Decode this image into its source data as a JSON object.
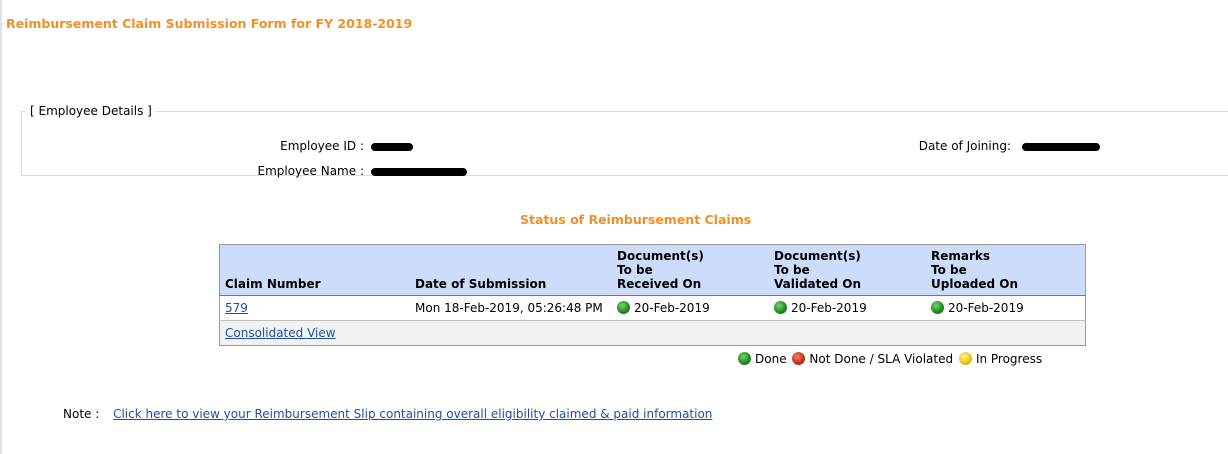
{
  "page": {
    "title": "Reimbursement Claim Submission Form for FY 2018-2019"
  },
  "employee_details": {
    "legend": "[ Employee Details ]",
    "employee_id_label": "Employee ID :",
    "employee_name_label": "Employee Name :",
    "date_of_joining_label": "Date of Joining:"
  },
  "status": {
    "title": "Status of Reimbursement Claims",
    "columns": {
      "claim_number": "Claim Number",
      "date_of_submission": "Date of Submission",
      "doc_received_1": "Document(s)",
      "doc_received_2": "To be",
      "doc_received_3": "Received On",
      "doc_validated_1": "Document(s)",
      "doc_validated_2": "To be",
      "doc_validated_3": "Validated On",
      "remarks_1": "Remarks",
      "remarks_2": "To be",
      "remarks_3": "Uploaded On"
    },
    "rows": [
      {
        "claim_number": "579",
        "date_of_submission": "Mon 18-Feb-2019, 05:26:48 PM",
        "received_on": "20-Feb-2019",
        "validated_on": "20-Feb-2019",
        "uploaded_on": "20-Feb-2019",
        "received_status": "done",
        "validated_status": "done",
        "uploaded_status": "done"
      }
    ],
    "consolidated_view": "Consolidated View"
  },
  "legend": {
    "done": "Done",
    "not_done": "Not Done / SLA Violated",
    "in_progress": "In Progress",
    "colors": {
      "done": "#1f8f1f",
      "not_done": "#c8321a",
      "in_progress": "#f2c514"
    }
  },
  "note": {
    "label": "Note :",
    "link": "Click here to view your Reimbursement Slip containing overall eligibility claimed & paid information"
  }
}
